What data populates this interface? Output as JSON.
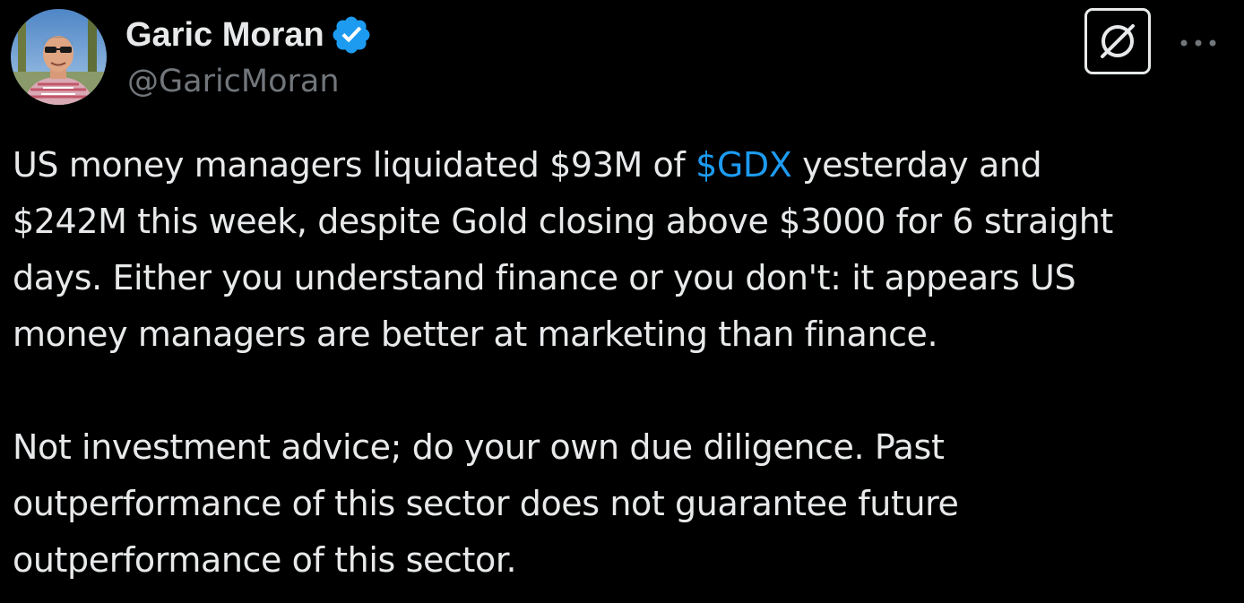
{
  "author": {
    "name": "Garic Moran",
    "handle": "@GaricMoran",
    "verified": true,
    "avatar_icon": "profile-photo"
  },
  "header": {
    "grok_icon": "grok-icon",
    "more_icon": "more-dots-icon"
  },
  "tweet": {
    "p1_line1_pre": "US money managers liquidated $93M of ",
    "cashtag": "$GDX",
    "p1_line1_post": " yesterday and",
    "p1_line2": "$242M this week, despite Gold closing above $3000 for 6 straight",
    "p1_line3": "days. Either you understand finance or you don't: it appears US",
    "p1_line4": "money managers are better at marketing than finance.",
    "p2_line1": "Not investment advice; do your own due diligence. Past",
    "p2_line2": "outperformance of this sector does not guarantee future",
    "p2_line3": "outperformance of this sector."
  },
  "colors": {
    "background": "#000000",
    "text": "#e7e9ea",
    "secondary": "#71767b",
    "link": "#1d9bf0",
    "verified": "#1d9bf0"
  }
}
